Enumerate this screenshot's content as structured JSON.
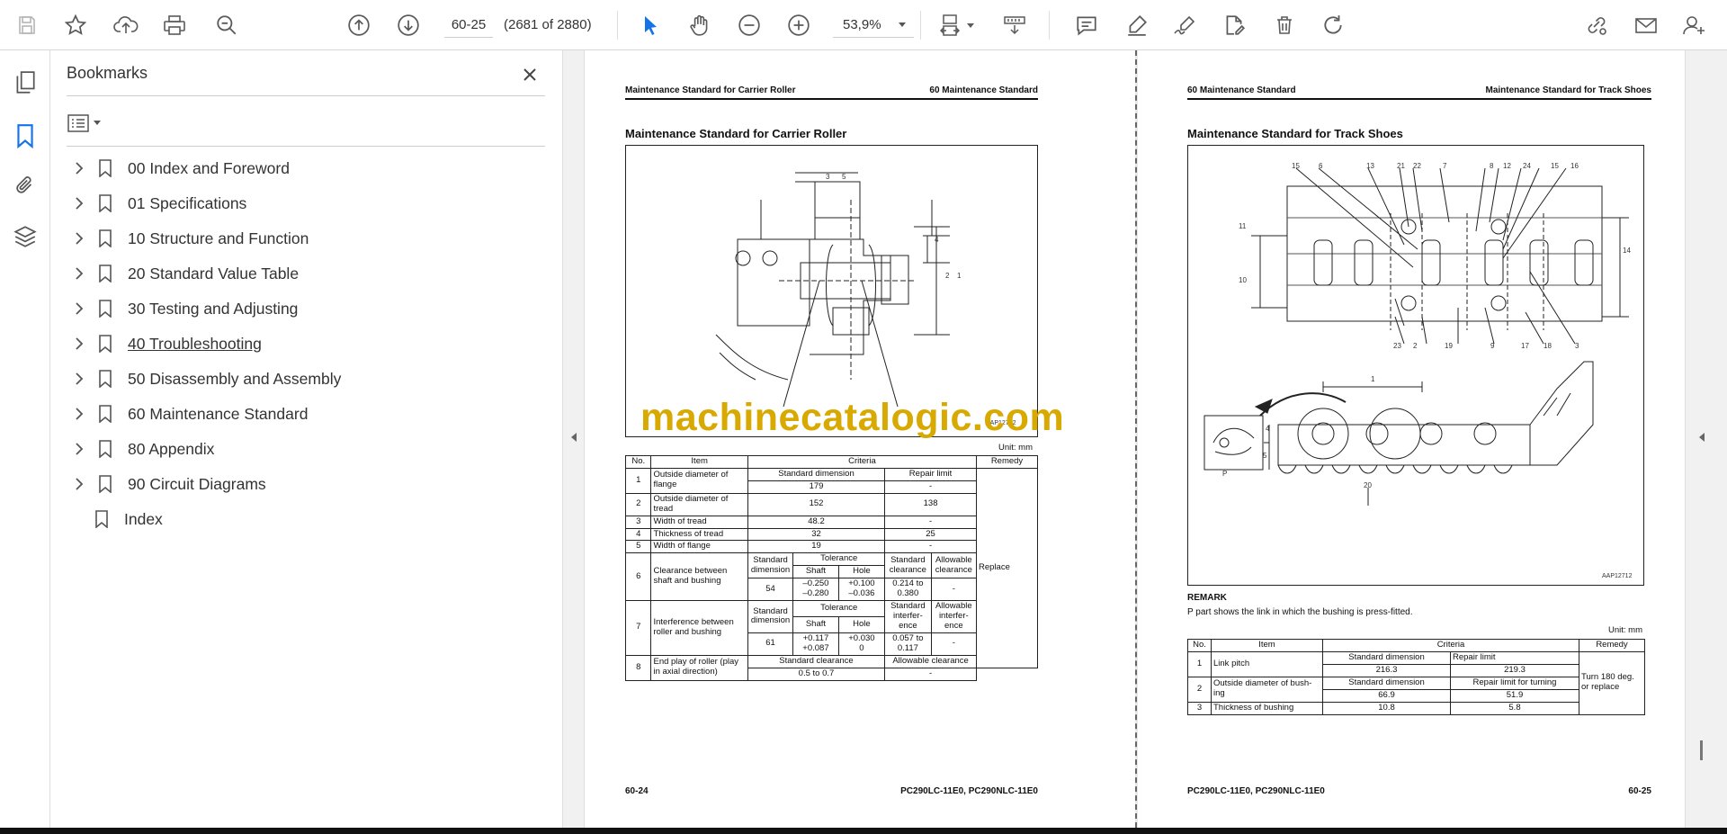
{
  "toolbar": {
    "tools": [
      "save-icon",
      "bookmark-star-icon",
      "upload-icon",
      "print-icon",
      "zoom-search-icon",
      "page-up-icon",
      "page-down-icon",
      "select-cursor-icon",
      "hand-icon",
      "zoom-out-icon",
      "zoom-in-icon",
      "fit-page-icon",
      "scroll-mode-icon",
      "comment-icon",
      "highlight-icon",
      "sign-icon",
      "edit-pdf-icon",
      "delete-icon",
      "rotate-icon",
      "share-link-icon",
      "email-icon",
      "add-user-icon"
    ],
    "page_value": "60-25",
    "page_count": "(2681 of 2880)",
    "zoom_value": "53,9%"
  },
  "left_rail": [
    "pages-icon",
    "bookmarks-icon",
    "attachments-icon",
    "layers-icon"
  ],
  "bookmarks": {
    "title": "Bookmarks",
    "items": [
      {
        "label": "00 Index and Foreword",
        "expandable": true
      },
      {
        "label": "01 Specifications",
        "expandable": true
      },
      {
        "label": "10 Structure and Function",
        "expandable": true
      },
      {
        "label": "20 Standard Value Table",
        "expandable": true
      },
      {
        "label": "30 Testing and Adjusting",
        "expandable": true
      },
      {
        "label": "40 Troubleshooting",
        "expandable": true,
        "hover": true
      },
      {
        "label": "50 Disassembly and Assembly",
        "expandable": true
      },
      {
        "label": "60 Maintenance Standard",
        "expandable": true
      },
      {
        "label": "80 Appendix",
        "expandable": true
      },
      {
        "label": "90 Circuit Diagrams",
        "expandable": true
      },
      {
        "label": "Index",
        "expandable": false
      }
    ]
  },
  "left_page": {
    "header_left": "Maintenance Standard for Carrier Roller",
    "header_right": "60 Maintenance Standard",
    "title": "Maintenance Standard for Carrier Roller",
    "fig_labels": [
      "3",
      "5",
      "4",
      "2",
      "1"
    ],
    "fig_code": "AAP12702",
    "unit": "Unit: mm",
    "table": {
      "h_no": "No.",
      "h_item": "Item",
      "h_criteria": "Criteria",
      "h_remedy": "Remedy",
      "std_dim": "Standard dimension",
      "repair_limit": "Repair limit",
      "r1_item": "Outside diameter of flange",
      "r1_std": "179",
      "r1_rep": "-",
      "r2_item": "Outside diameter of tread",
      "r2_std": "152",
      "r2_rep": "138",
      "r3_item": "Width of tread",
      "r3_std": "48.2",
      "r3_rep": "-",
      "r4_item": "Thickness of tread",
      "r4_std": "32",
      "r4_rep": "25",
      "r5_item": "Width of flange",
      "r5_std": "19",
      "r5_rep": "-",
      "r6_item": "Clearance between shaft and bushing",
      "r6_stddim": "Standard dimension",
      "r6_tol": "Tolerance",
      "r6_stdcl": "Standard clearance",
      "r6_allcl": "Allowable clearance",
      "r6_shaft": "Shaft",
      "r6_hole": "Hole",
      "r6_dim": "54",
      "r6_shaft_v": "–0.250\n–0.280",
      "r6_hole_v": "+0.100\n–0.036",
      "r6_cl": "0.214 to\n0.380",
      "r6_all": "-",
      "r7_item": "Interference between roller and bushing",
      "r7_stddim": "Standard dimension",
      "r7_tol": "Tolerance",
      "r7_stdint": "Standard interfer-\nence",
      "r7_allint": "Allowable interfer-\nence",
      "r7_shaft": "Shaft",
      "r7_hole": "Hole",
      "r7_dim": "61",
      "r7_shaft_v": "+0.117\n+0.087",
      "r7_hole_v": "+0.030\n0",
      "r7_int": "0.057 to\n0.117",
      "r7_all": "-",
      "r8_item": "End play of roller (play in axial direction)",
      "r8_stdcl": "Standard clearance",
      "r8_allcl": "Allowable clearance",
      "r8_std": "0.5 to 0.7",
      "r8_all": "-",
      "remedy": "Replace",
      "nums": [
        "1",
        "2",
        "3",
        "4",
        "5",
        "6",
        "7",
        "8"
      ]
    },
    "footer_left": "60-24",
    "footer_right": "PC290LC-11E0, PC290NLC-11E0"
  },
  "right_page": {
    "header_left": "60 Maintenance Standard",
    "header_right": "Maintenance Standard for Track Shoes",
    "title": "Maintenance Standard for Track Shoes",
    "fig_labels_top": [
      "15",
      "6",
      "13",
      "21",
      "22",
      "7",
      "8",
      "12",
      "24",
      "15",
      "16"
    ],
    "fig_labels_side": [
      "11",
      "10",
      "14"
    ],
    "fig_labels_bottom": [
      "23",
      "2",
      "19",
      "9",
      "17",
      "18",
      "3"
    ],
    "fig_labels_lower": [
      "1",
      "4",
      "5",
      "20",
      "P"
    ],
    "fig_code": "AAP12712",
    "remark_title": "REMARK",
    "remark_text": "P part shows the link in which the bushing is press-fitted.",
    "unit": "Unit: mm",
    "table": {
      "h_no": "No.",
      "h_item": "Item",
      "h_criteria": "Criteria",
      "h_remedy": "Remedy",
      "r1_item": "Link pitch",
      "r1_std_h": "Standard dimension",
      "r1_rep_h": "Repair limit",
      "r1_std": "216.3",
      "r1_rep": "219.3",
      "r2_item": "Outside diameter of bush-\ning",
      "r2_std_h": "Standard dimension",
      "r2_rep_h": "Repair limit for turning",
      "r2_std": "66.9",
      "r2_rep": "51.9",
      "r3_item": "Thickness of bushing",
      "r3_std": "10.8",
      "r3_rep": "5.8",
      "remedy": "Turn 180 deg.\nor replace",
      "nums": [
        "1",
        "2",
        "3"
      ]
    },
    "footer_left": "PC290LC-11E0, PC290NLC-11E0",
    "footer_right": "60-25"
  },
  "watermark": "machinecatalogic.com"
}
